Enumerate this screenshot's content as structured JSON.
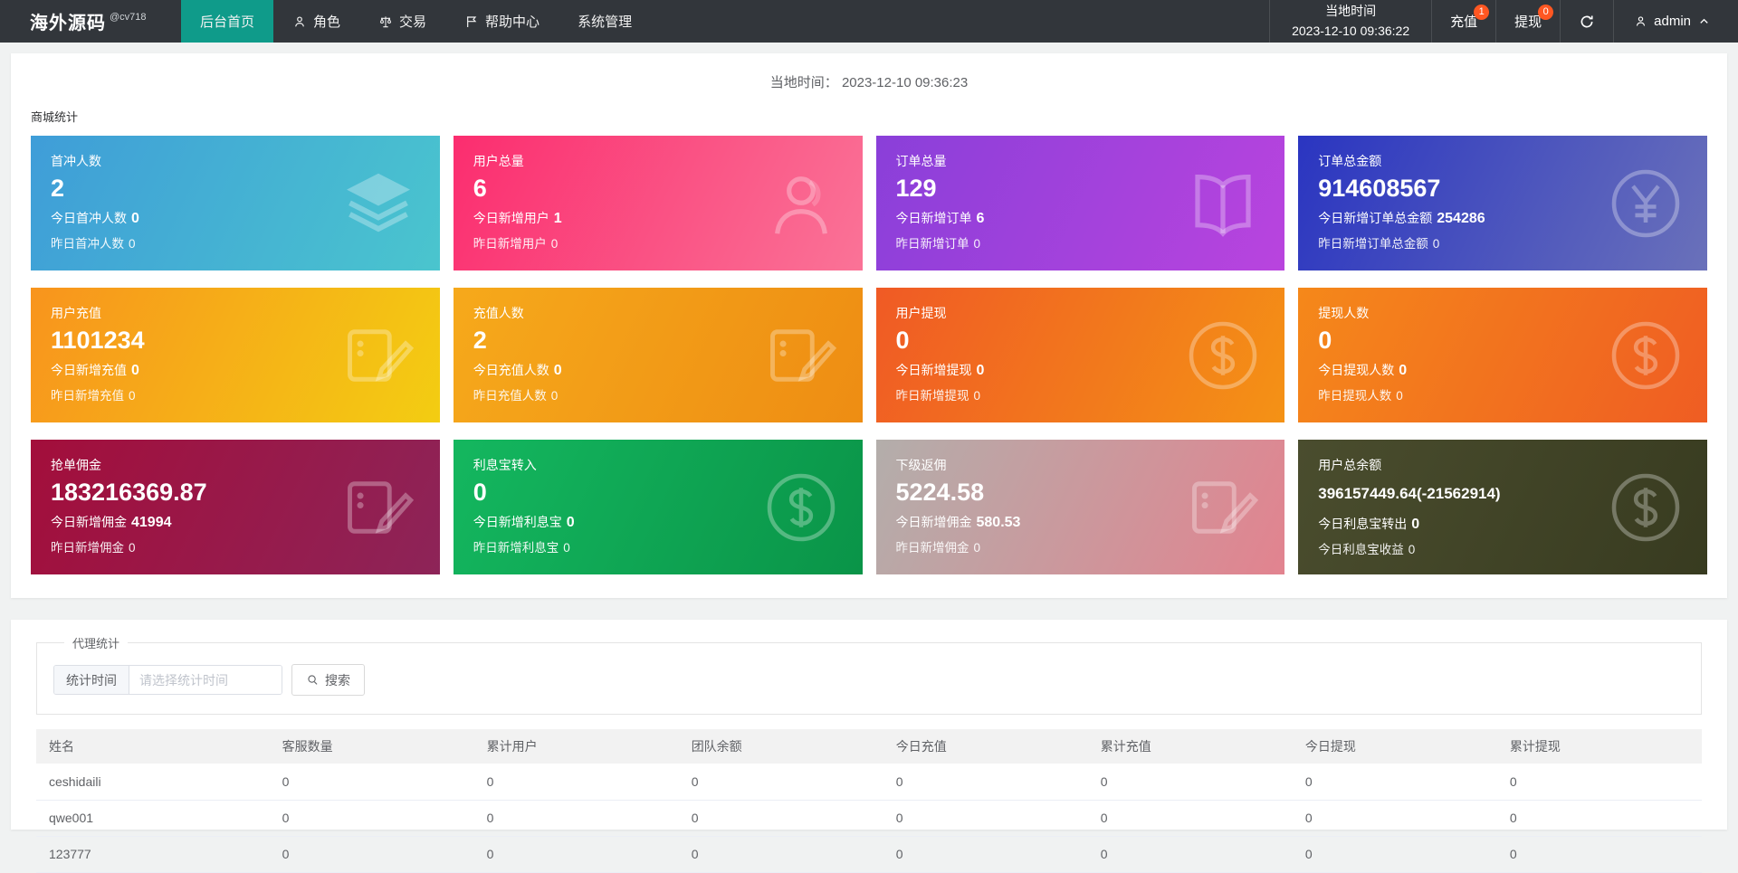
{
  "colors": {
    "navbar_bg": "#32363b",
    "active_tab": "#0f9b8a",
    "badge_bg": "#ff5722"
  },
  "navbar": {
    "brand": "海外源码",
    "brand_sub": "@cv718",
    "items": [
      {
        "label": "后台首页",
        "active": true
      },
      {
        "label": "角色",
        "icon": "user-icon"
      },
      {
        "label": "交易",
        "icon": "scales-icon"
      },
      {
        "label": "帮助中心",
        "icon": "flag-icon"
      },
      {
        "label": "系统管理"
      }
    ],
    "local_time_label": "当地时间",
    "local_time_value": "2023-12-10 09:36:22",
    "recharge_label": "充值",
    "recharge_badge": "1",
    "withdraw_label": "提现",
    "withdraw_badge": "0",
    "username": "admin"
  },
  "overview": {
    "local_time_label": "当地时间：",
    "local_time_value": "2023-12-10 09:36:23",
    "section_title": "商城统计",
    "cards": [
      {
        "title": "首冲人数",
        "value": "2",
        "line2_label": "今日首冲人数",
        "line2_value": "0",
        "line3_label": "昨日首冲人数",
        "line3_value": "0",
        "icon": "layers-icon",
        "gradient": [
          "#3f9dd8",
          "#4ac5ce"
        ]
      },
      {
        "title": "用户总量",
        "value": "6",
        "line2_label": "今日新增用户",
        "line2_value": "1",
        "line3_label": "昨日新增用户",
        "line3_value": "0",
        "icon": "person-icon",
        "gradient": [
          "#fb2d6f",
          "#fa7397"
        ]
      },
      {
        "title": "订单总量",
        "value": "129",
        "line2_label": "今日新增订单",
        "line2_value": "6",
        "line3_label": "昨日新增订单",
        "line3_value": "0",
        "icon": "book-icon",
        "gradient": [
          "#8a3fd9",
          "#b944de"
        ]
      },
      {
        "title": "订单总金额",
        "value": "914608567",
        "line2_label": "今日新增订单总金额",
        "line2_value": "254286",
        "line3_label": "昨日新增订单总金额",
        "line3_value": "0",
        "icon": "yen-circle-icon",
        "gradient": [
          "#2a35c1",
          "#6a71ba"
        ]
      },
      {
        "title": "用户充值",
        "value": "1101234",
        "line2_label": "今日新增充值",
        "line2_value": "0",
        "line3_label": "昨日新增充值",
        "line3_value": "0",
        "icon": "edit-note-icon",
        "gradient": [
          "#f8941d",
          "#f3cd12"
        ]
      },
      {
        "title": "充值人数",
        "value": "2",
        "line2_label": "今日充值人数",
        "line2_value": "0",
        "line3_label": "昨日充值人数",
        "line3_value": "0",
        "icon": "edit-note-icon",
        "gradient": [
          "#f6a91b",
          "#ee8d13"
        ]
      },
      {
        "title": "用户提现",
        "value": "0",
        "line2_label": "今日新增提现",
        "line2_value": "0",
        "line3_label": "昨日新增提现",
        "line3_value": "0",
        "icon": "dollar-circle-icon",
        "gradient": [
          "#f05a25",
          "#f49215"
        ]
      },
      {
        "title": "提现人数",
        "value": "0",
        "line2_label": "今日提现人数",
        "line2_value": "0",
        "line3_label": "昨日提现人数",
        "line3_value": "0",
        "icon": "dollar-circle-icon",
        "gradient": [
          "#f5881a",
          "#ef5d23"
        ]
      },
      {
        "title": "抢单佣金",
        "value": "183216369.87",
        "line2_label": "今日新增佣金",
        "line2_value": "41994",
        "line3_label": "昨日新增佣金",
        "line3_value": "0",
        "icon": "edit-note-icon",
        "gradient": [
          "#a30e3b",
          "#8d2458"
        ]
      },
      {
        "title": "利息宝转入",
        "value": "0",
        "line2_label": "今日新增利息宝",
        "line2_value": "0",
        "line3_label": "昨日新增利息宝",
        "line3_value": "0",
        "icon": "dollar-circle-icon",
        "gradient": [
          "#14b75f",
          "#0a9448"
        ]
      },
      {
        "title": "下级返佣",
        "value": "5224.58",
        "line2_label": "今日新增佣金",
        "line2_value": "580.53",
        "line3_label": "昨日新增佣金",
        "line3_value": "0",
        "icon": "edit-note-icon",
        "gradient": [
          "#b3aeab",
          "#e2838f"
        ]
      },
      {
        "title": "用户总余额",
        "value": "396157449.64(-21562914)",
        "value_small": true,
        "line2_label": "今日利息宝转出",
        "line2_value": "0",
        "line3_label": "今日利息宝收益",
        "line3_value": "0",
        "icon": "dollar-circle-icon",
        "gradient": [
          "#4a4d2e",
          "#383b20"
        ]
      }
    ]
  },
  "agent": {
    "legend": "代理统计",
    "filter_label": "统计时间",
    "filter_placeholder": "请选择统计时间",
    "search_label": "搜索",
    "table": {
      "headers": [
        "姓名",
        "客服数量",
        "累计用户",
        "团队余额",
        "今日充值",
        "累计充值",
        "今日提现",
        "累计提现"
      ],
      "rows": [
        [
          "ceshidaili",
          "0",
          "0",
          "0",
          "0",
          "0",
          "0",
          "0"
        ],
        [
          "qwe001",
          "0",
          "0",
          "0",
          "0",
          "0",
          "0",
          "0"
        ],
        [
          "123777",
          "0",
          "0",
          "0",
          "0",
          "0",
          "0",
          "0"
        ]
      ]
    }
  }
}
